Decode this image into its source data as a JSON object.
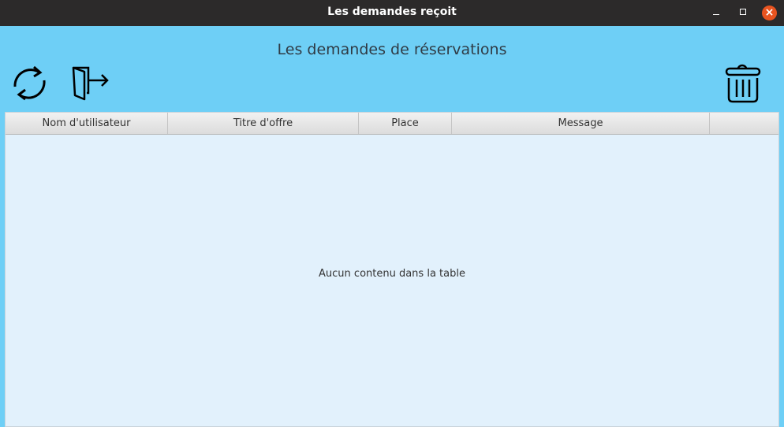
{
  "window": {
    "title": "Les demandes reçoit",
    "minimize": "–",
    "maximize": "□",
    "close": "×"
  },
  "heading": "Les demandes de réservations",
  "toolbar": {
    "refresh_icon": "refresh-icon",
    "exit_icon": "exit-door-icon",
    "delete_icon": "trash-icon"
  },
  "table": {
    "columns": [
      "Nom d'utilisateur",
      "Titre d'offre",
      "Place",
      "Message",
      ""
    ],
    "placeholder": "Aucun contenu dans la table",
    "rows": []
  }
}
